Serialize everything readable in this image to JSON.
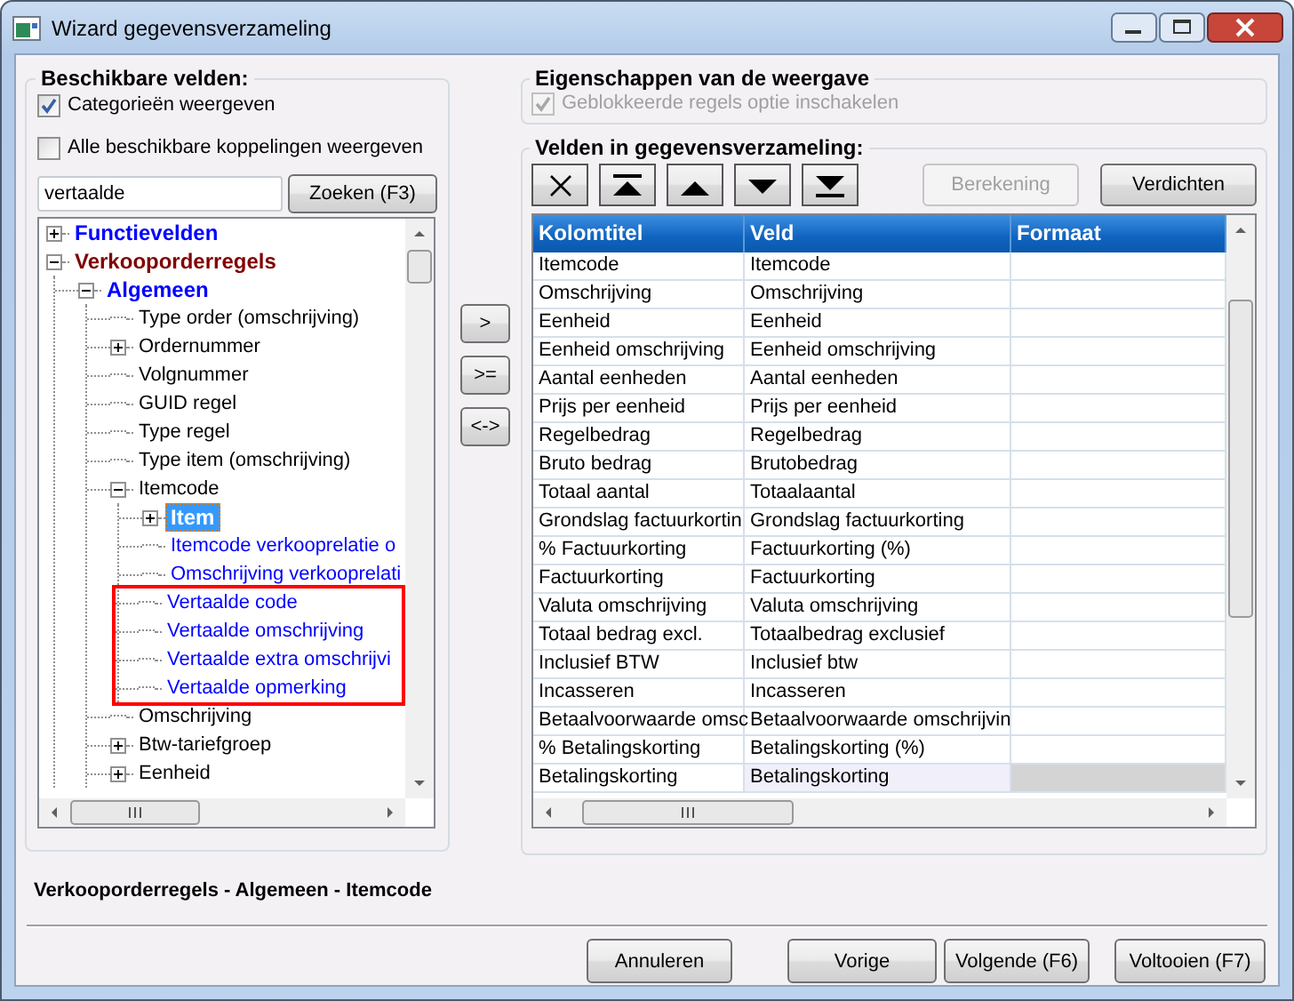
{
  "window": {
    "title": "Wizard gegevensverzameling"
  },
  "available_fields": {
    "heading": "Beschikbare velden:",
    "options": [
      {
        "label": "Categorieën weergeven",
        "checked": true
      },
      {
        "label": "Alle beschikbare koppelingen weergeven",
        "checked": false
      }
    ],
    "search": {
      "value": "vertaalde",
      "button": "Zoeken (F3)"
    },
    "tree": [
      {
        "label": "Functievelden",
        "kind": "category",
        "expanded": false,
        "selected": false,
        "highlighted": false
      },
      {
        "label": "Verkooporderregels",
        "kind": "root",
        "expanded": true,
        "selected": false,
        "highlighted": false,
        "children": [
          {
            "label": "Algemeen",
            "kind": "category",
            "expanded": true,
            "selected": false,
            "highlighted": false,
            "children": [
              {
                "label": "Type order (omschrijving)",
                "kind": "field",
                "selected": false,
                "highlighted": false
              },
              {
                "label": "Ordernummer",
                "kind": "field",
                "expanded": false,
                "selected": false,
                "highlighted": false
              },
              {
                "label": "Volgnummer",
                "kind": "field",
                "selected": false,
                "highlighted": false
              },
              {
                "label": "GUID regel",
                "kind": "field",
                "selected": false,
                "highlighted": false
              },
              {
                "label": "Type regel",
                "kind": "field",
                "selected": false,
                "highlighted": false
              },
              {
                "label": "Type item (omschrijving)",
                "kind": "field",
                "selected": false,
                "highlighted": false
              },
              {
                "label": "Itemcode",
                "kind": "field",
                "expanded": true,
                "selected": false,
                "highlighted": false,
                "children": [
                  {
                    "label": "Item",
                    "kind": "category",
                    "expanded": false,
                    "selected": true,
                    "highlighted": false
                  },
                  {
                    "label": "Itemcode verkooprelatie o",
                    "kind": "linked",
                    "selected": false,
                    "highlighted": false
                  },
                  {
                    "label": "Omschrijving verkooprelati",
                    "kind": "linked",
                    "selected": false,
                    "highlighted": false
                  },
                  {
                    "label": "Vertaalde code",
                    "kind": "linked",
                    "selected": false,
                    "highlighted": true
                  },
                  {
                    "label": "Vertaalde omschrijving",
                    "kind": "linked",
                    "selected": false,
                    "highlighted": true
                  },
                  {
                    "label": "Vertaalde extra omschrijvi",
                    "kind": "linked",
                    "selected": false,
                    "highlighted": true
                  },
                  {
                    "label": "Vertaalde opmerking",
                    "kind": "linked",
                    "selected": false,
                    "highlighted": true
                  }
                ]
              },
              {
                "label": "Omschrijving",
                "kind": "field",
                "selected": false,
                "highlighted": false
              },
              {
                "label": "Btw-tariefgroep",
                "kind": "field",
                "expanded": false,
                "selected": false,
                "highlighted": false
              },
              {
                "label": "Eenheid",
                "kind": "field",
                "expanded": false,
                "selected": false,
                "highlighted": false
              }
            ]
          }
        ]
      }
    ]
  },
  "transfer_buttons": [
    ">",
    ">=",
    "<->"
  ],
  "display_properties": {
    "heading": "Eigenschappen van de weergave",
    "options": [
      {
        "label": "Geblokkeerde regels optie inschakelen",
        "checked": true,
        "disabled": true
      }
    ]
  },
  "dataset_fields": {
    "heading": "Velden in gegevensverzameling:",
    "actions": [
      {
        "label": "Berekening",
        "disabled": true
      },
      {
        "label": "Verdichten",
        "disabled": false
      }
    ],
    "table": {
      "columns": [
        "Kolomtitel",
        "Veld",
        "Formaat"
      ],
      "rows": [
        {
          "cells": [
            "Itemcode",
            "Itemcode"
          ],
          "selected": false
        },
        {
          "cells": [
            "Omschrijving",
            "Omschrijving"
          ],
          "selected": false
        },
        {
          "cells": [
            "Eenheid",
            "Eenheid"
          ],
          "selected": false
        },
        {
          "cells": [
            "Eenheid omschrijving",
            "Eenheid omschrijving"
          ],
          "selected": false
        },
        {
          "cells": [
            "Aantal eenheden",
            "Aantal eenheden"
          ],
          "selected": false
        },
        {
          "cells": [
            "Prijs per eenheid",
            "Prijs per eenheid"
          ],
          "selected": false
        },
        {
          "cells": [
            "Regelbedrag",
            "Regelbedrag"
          ],
          "selected": false
        },
        {
          "cells": [
            "Bruto bedrag",
            "Brutobedrag"
          ],
          "selected": false
        },
        {
          "cells": [
            "Totaal aantal",
            "Totaalaantal"
          ],
          "selected": false
        },
        {
          "cells": [
            "Grondslag factuurkortin",
            "Grondslag factuurkorting"
          ],
          "selected": false
        },
        {
          "cells": [
            "% Factuurkorting",
            "Factuurkorting (%)"
          ],
          "selected": false
        },
        {
          "cells": [
            "Factuurkorting",
            "Factuurkorting"
          ],
          "selected": false
        },
        {
          "cells": [
            "Valuta omschrijving",
            "Valuta omschrijving"
          ],
          "selected": false
        },
        {
          "cells": [
            "Totaal bedrag excl.",
            "Totaalbedrag exclusief"
          ],
          "selected": false
        },
        {
          "cells": [
            "Inclusief BTW",
            "Inclusief btw"
          ],
          "selected": false
        },
        {
          "cells": [
            "Incasseren",
            "Incasseren"
          ],
          "selected": false
        },
        {
          "cells": [
            "Betaalvoorwaarde omsc",
            "Betaalvoorwaarde omschrijvin"
          ],
          "selected": false
        },
        {
          "cells": [
            "% Betalingskorting",
            "Betalingskorting (%)"
          ],
          "selected": false
        },
        {
          "cells": [
            "Betalingskorting",
            "Betalingskorting"
          ],
          "selected": true
        }
      ]
    }
  },
  "status": "Verkooporderregels - Algemeen - Itemcode",
  "buttons": [
    "Annuleren",
    "Vorige",
    "Volgende (F6)",
    "Voltooien (F7)"
  ]
}
